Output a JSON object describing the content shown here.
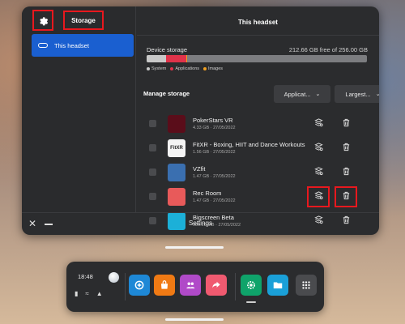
{
  "sidebar": {
    "settings_icon": "gear-icon",
    "storage_tab": "Storage",
    "items": [
      {
        "label": "This headset",
        "icon": "headset-icon"
      }
    ]
  },
  "header": {
    "title": "This headset"
  },
  "device_storage": {
    "label": "Device storage",
    "free_text": "212.66 GB free of 256.00 GB",
    "segments": [
      {
        "name": "System",
        "fraction": 0.09,
        "color": "#c8c8c8"
      },
      {
        "name": "Applications",
        "fraction": 0.09,
        "color": "#e0334a"
      },
      {
        "name": "Images",
        "fraction": 0.003,
        "color": "#f0a020"
      }
    ],
    "legend": [
      {
        "label": "System",
        "color": "#c8c8c8"
      },
      {
        "label": "Applications",
        "color": "#e0334a"
      },
      {
        "label": "Images",
        "color": "#f0a020"
      }
    ]
  },
  "manage": {
    "label": "Manage storage",
    "filter_value": "Applicat...",
    "sort_value": "Largest..."
  },
  "apps": [
    {
      "name": "PokerStars VR",
      "meta": "4.33 GB · 27/05/2022",
      "icon_bg": "#5a0d1a",
      "icon_text": ""
    },
    {
      "name": "FitXR - Boxing, HIIT and Dance Workouts",
      "meta": "1.56 GB · 27/05/2022",
      "icon_bg": "#f4f4f4",
      "icon_text": "FitXR"
    },
    {
      "name": "VZfit",
      "meta": "1.47 GB · 27/05/2022",
      "icon_bg": "#3a6fb0",
      "icon_text": ""
    },
    {
      "name": "Rec Room",
      "meta": "1.47 GB · 27/05/2022",
      "icon_bg": "#e85a5a",
      "icon_text": ""
    },
    {
      "name": "Bigscreen Beta",
      "meta": "989.28 MB · 27/05/2022",
      "icon_bg": "#1cb0d8",
      "icon_text": ""
    }
  ],
  "footer": {
    "label": "Settings"
  },
  "taskbar": {
    "time": "18:48",
    "apps": [
      {
        "name": "explore",
        "color": "#1e88d6"
      },
      {
        "name": "store",
        "color": "#f07a14"
      },
      {
        "name": "people",
        "color": "#b04ac8"
      },
      {
        "name": "share",
        "color": "#f05a70"
      },
      {
        "name": "settings",
        "color": "#0fa36a"
      },
      {
        "name": "files",
        "color": "#1aa0d8"
      },
      {
        "name": "app-library",
        "color": "#4a4b4e"
      }
    ]
  },
  "highlight_color": "#e8181e"
}
